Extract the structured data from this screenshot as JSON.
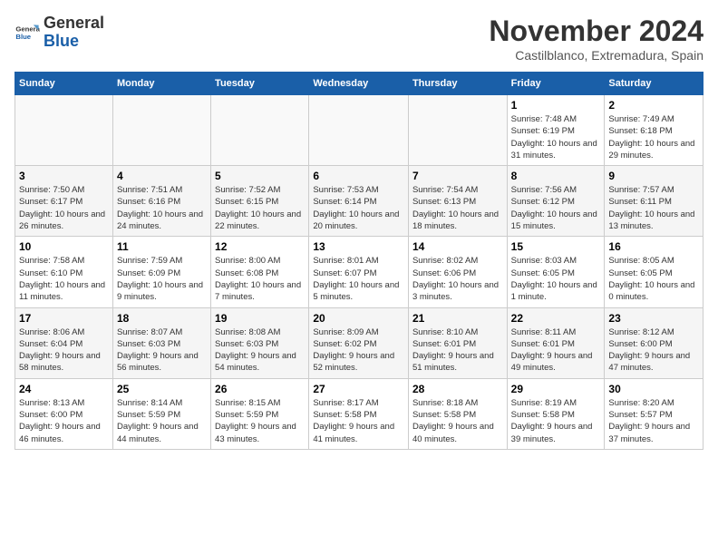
{
  "logo": {
    "general": "General",
    "blue": "Blue"
  },
  "title": "November 2024",
  "location": "Castilblanco, Extremadura, Spain",
  "days_of_week": [
    "Sunday",
    "Monday",
    "Tuesday",
    "Wednesday",
    "Thursday",
    "Friday",
    "Saturday"
  ],
  "weeks": [
    [
      {
        "day": "",
        "info": ""
      },
      {
        "day": "",
        "info": ""
      },
      {
        "day": "",
        "info": ""
      },
      {
        "day": "",
        "info": ""
      },
      {
        "day": "",
        "info": ""
      },
      {
        "day": "1",
        "info": "Sunrise: 7:48 AM\nSunset: 6:19 PM\nDaylight: 10 hours\nand 31 minutes."
      },
      {
        "day": "2",
        "info": "Sunrise: 7:49 AM\nSunset: 6:18 PM\nDaylight: 10 hours\nand 29 minutes."
      }
    ],
    [
      {
        "day": "3",
        "info": "Sunrise: 7:50 AM\nSunset: 6:17 PM\nDaylight: 10 hours\nand 26 minutes."
      },
      {
        "day": "4",
        "info": "Sunrise: 7:51 AM\nSunset: 6:16 PM\nDaylight: 10 hours\nand 24 minutes."
      },
      {
        "day": "5",
        "info": "Sunrise: 7:52 AM\nSunset: 6:15 PM\nDaylight: 10 hours\nand 22 minutes."
      },
      {
        "day": "6",
        "info": "Sunrise: 7:53 AM\nSunset: 6:14 PM\nDaylight: 10 hours\nand 20 minutes."
      },
      {
        "day": "7",
        "info": "Sunrise: 7:54 AM\nSunset: 6:13 PM\nDaylight: 10 hours\nand 18 minutes."
      },
      {
        "day": "8",
        "info": "Sunrise: 7:56 AM\nSunset: 6:12 PM\nDaylight: 10 hours\nand 15 minutes."
      },
      {
        "day": "9",
        "info": "Sunrise: 7:57 AM\nSunset: 6:11 PM\nDaylight: 10 hours\nand 13 minutes."
      }
    ],
    [
      {
        "day": "10",
        "info": "Sunrise: 7:58 AM\nSunset: 6:10 PM\nDaylight: 10 hours\nand 11 minutes."
      },
      {
        "day": "11",
        "info": "Sunrise: 7:59 AM\nSunset: 6:09 PM\nDaylight: 10 hours\nand 9 minutes."
      },
      {
        "day": "12",
        "info": "Sunrise: 8:00 AM\nSunset: 6:08 PM\nDaylight: 10 hours\nand 7 minutes."
      },
      {
        "day": "13",
        "info": "Sunrise: 8:01 AM\nSunset: 6:07 PM\nDaylight: 10 hours\nand 5 minutes."
      },
      {
        "day": "14",
        "info": "Sunrise: 8:02 AM\nSunset: 6:06 PM\nDaylight: 10 hours\nand 3 minutes."
      },
      {
        "day": "15",
        "info": "Sunrise: 8:03 AM\nSunset: 6:05 PM\nDaylight: 10 hours\nand 1 minute."
      },
      {
        "day": "16",
        "info": "Sunrise: 8:05 AM\nSunset: 6:05 PM\nDaylight: 10 hours\nand 0 minutes."
      }
    ],
    [
      {
        "day": "17",
        "info": "Sunrise: 8:06 AM\nSunset: 6:04 PM\nDaylight: 9 hours\nand 58 minutes."
      },
      {
        "day": "18",
        "info": "Sunrise: 8:07 AM\nSunset: 6:03 PM\nDaylight: 9 hours\nand 56 minutes."
      },
      {
        "day": "19",
        "info": "Sunrise: 8:08 AM\nSunset: 6:03 PM\nDaylight: 9 hours\nand 54 minutes."
      },
      {
        "day": "20",
        "info": "Sunrise: 8:09 AM\nSunset: 6:02 PM\nDaylight: 9 hours\nand 52 minutes."
      },
      {
        "day": "21",
        "info": "Sunrise: 8:10 AM\nSunset: 6:01 PM\nDaylight: 9 hours\nand 51 minutes."
      },
      {
        "day": "22",
        "info": "Sunrise: 8:11 AM\nSunset: 6:01 PM\nDaylight: 9 hours\nand 49 minutes."
      },
      {
        "day": "23",
        "info": "Sunrise: 8:12 AM\nSunset: 6:00 PM\nDaylight: 9 hours\nand 47 minutes."
      }
    ],
    [
      {
        "day": "24",
        "info": "Sunrise: 8:13 AM\nSunset: 6:00 PM\nDaylight: 9 hours\nand 46 minutes."
      },
      {
        "day": "25",
        "info": "Sunrise: 8:14 AM\nSunset: 5:59 PM\nDaylight: 9 hours\nand 44 minutes."
      },
      {
        "day": "26",
        "info": "Sunrise: 8:15 AM\nSunset: 5:59 PM\nDaylight: 9 hours\nand 43 minutes."
      },
      {
        "day": "27",
        "info": "Sunrise: 8:17 AM\nSunset: 5:58 PM\nDaylight: 9 hours\nand 41 minutes."
      },
      {
        "day": "28",
        "info": "Sunrise: 8:18 AM\nSunset: 5:58 PM\nDaylight: 9 hours\nand 40 minutes."
      },
      {
        "day": "29",
        "info": "Sunrise: 8:19 AM\nSunset: 5:58 PM\nDaylight: 9 hours\nand 39 minutes."
      },
      {
        "day": "30",
        "info": "Sunrise: 8:20 AM\nSunset: 5:57 PM\nDaylight: 9 hours\nand 37 minutes."
      }
    ]
  ]
}
